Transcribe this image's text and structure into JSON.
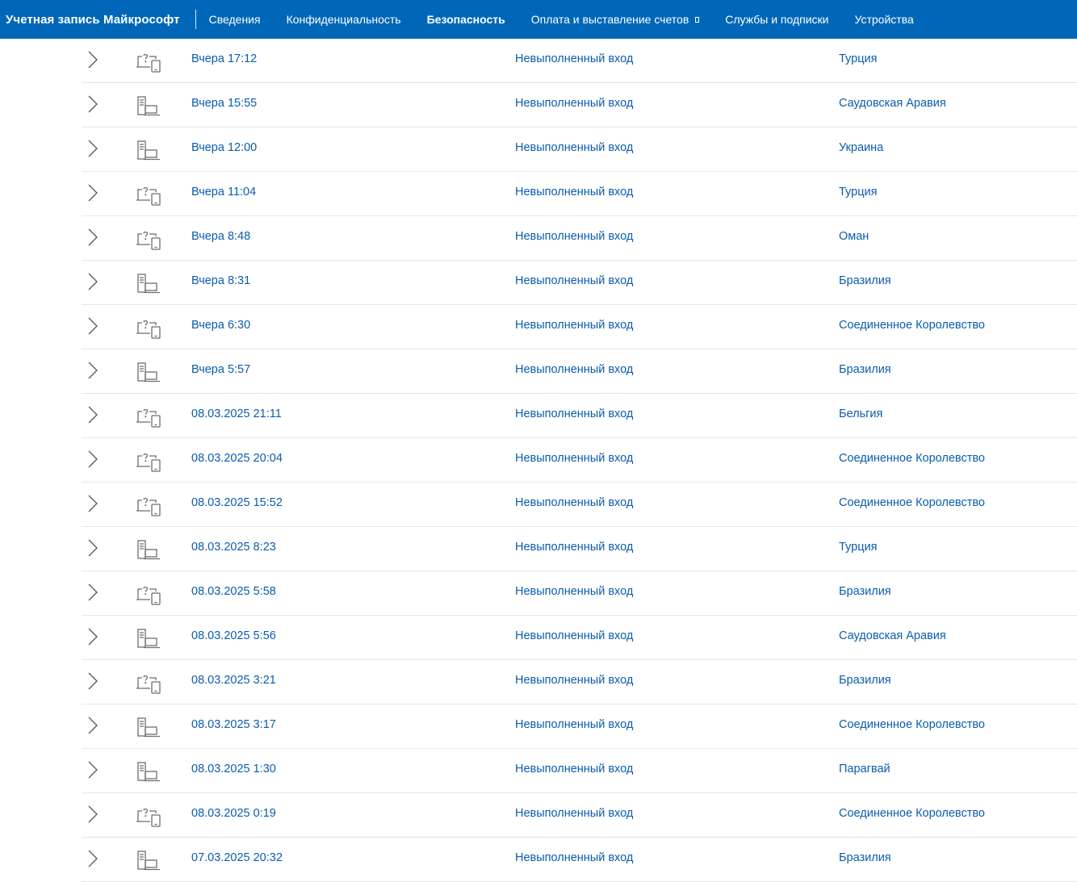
{
  "header": {
    "brand": "Учетная запись Майкрософт",
    "nav": [
      {
        "label": "Сведения",
        "active": false
      },
      {
        "label": "Конфиденциальность",
        "active": false
      },
      {
        "label": "Безопасность",
        "active": true
      },
      {
        "label": "Оплата и выставление счетов",
        "active": false,
        "has_dropdown": true
      },
      {
        "label": "Службы и подписки",
        "active": false
      },
      {
        "label": "Устройства",
        "active": false
      }
    ]
  },
  "activity": {
    "rows": [
      {
        "time": "Вчера 17:12",
        "status": "Невыполненный вход",
        "country": "Турция",
        "device_icon": "unknown-device-icon"
      },
      {
        "time": "Вчера 15:55",
        "status": "Невыполненный вход",
        "country": "Саудовская Аравия",
        "device_icon": "desktop-laptop-icon"
      },
      {
        "time": "Вчера 12:00",
        "status": "Невыполненный вход",
        "country": "Украина",
        "device_icon": "desktop-laptop-icon"
      },
      {
        "time": "Вчера 11:04",
        "status": "Невыполненный вход",
        "country": "Турция",
        "device_icon": "unknown-device-icon"
      },
      {
        "time": "Вчера 8:48",
        "status": "Невыполненный вход",
        "country": "Оман",
        "device_icon": "unknown-device-icon"
      },
      {
        "time": "Вчера 8:31",
        "status": "Невыполненный вход",
        "country": "Бразилия",
        "device_icon": "desktop-laptop-icon"
      },
      {
        "time": "Вчера 6:30",
        "status": "Невыполненный вход",
        "country": "Соединенное Королевство",
        "device_icon": "unknown-device-icon"
      },
      {
        "time": "Вчера 5:57",
        "status": "Невыполненный вход",
        "country": "Бразилия",
        "device_icon": "desktop-laptop-icon"
      },
      {
        "time": "08.03.2025 21:11",
        "status": "Невыполненный вход",
        "country": "Бельгия",
        "device_icon": "unknown-device-icon"
      },
      {
        "time": "08.03.2025 20:04",
        "status": "Невыполненный вход",
        "country": "Соединенное Королевство",
        "device_icon": "unknown-device-icon"
      },
      {
        "time": "08.03.2025 15:52",
        "status": "Невыполненный вход",
        "country": "Соединенное Королевство",
        "device_icon": "unknown-device-icon"
      },
      {
        "time": "08.03.2025 8:23",
        "status": "Невыполненный вход",
        "country": "Турция",
        "device_icon": "desktop-laptop-icon"
      },
      {
        "time": "08.03.2025 5:58",
        "status": "Невыполненный вход",
        "country": "Бразилия",
        "device_icon": "unknown-device-icon"
      },
      {
        "time": "08.03.2025 5:56",
        "status": "Невыполненный вход",
        "country": "Саудовская Аравия",
        "device_icon": "desktop-laptop-icon"
      },
      {
        "time": "08.03.2025 3:21",
        "status": "Невыполненный вход",
        "country": "Бразилия",
        "device_icon": "unknown-device-icon"
      },
      {
        "time": "08.03.2025 3:17",
        "status": "Невыполненный вход",
        "country": "Соединенное Королевство",
        "device_icon": "desktop-laptop-icon"
      },
      {
        "time": "08.03.2025 1:30",
        "status": "Невыполненный вход",
        "country": "Парагвай",
        "device_icon": "desktop-laptop-icon"
      },
      {
        "time": "08.03.2025 0:19",
        "status": "Невыполненный вход",
        "country": "Соединенное Королевство",
        "device_icon": "unknown-device-icon"
      },
      {
        "time": "07.03.2025 20:32",
        "status": "Невыполненный вход",
        "country": "Бразилия",
        "device_icon": "desktop-laptop-icon"
      }
    ]
  },
  "colors": {
    "header_bg": "#0067b8",
    "link": "#0b5cad",
    "icon": "#6e6e6e",
    "row_divider": "#e6e6e6"
  }
}
